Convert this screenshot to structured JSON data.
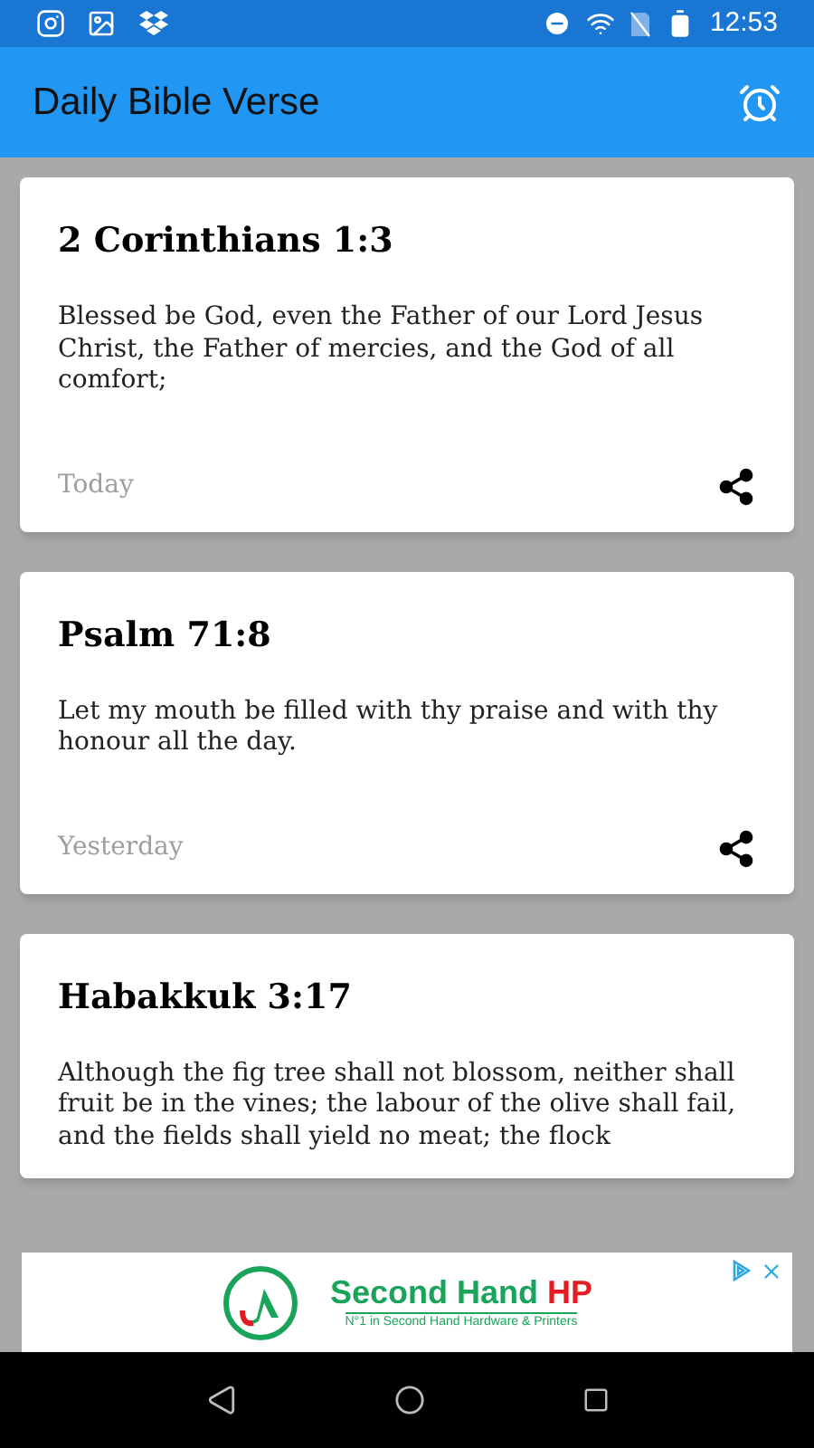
{
  "status_bar": {
    "time": "12:53"
  },
  "app_bar": {
    "title": "Daily Bible Verse"
  },
  "verses": [
    {
      "reference": "2 Corinthians 1:3",
      "text": "Blessed be God, even the Father of our Lord Jesus Christ, the Father of mercies, and the God of all comfort;",
      "date": "Today"
    },
    {
      "reference": "Psalm 71:8",
      "text": "Let my mouth be filled with thy praise and with thy honour all the day.",
      "date": "Yesterday"
    },
    {
      "reference": "Habakkuk 3:17",
      "text": "Although the fig tree shall not blossom, neither shall fruit be in the vines; the labour of the olive shall fail, and the fields shall yield no meat; the flock"
    }
  ],
  "ad": {
    "brand": "Second Hand",
    "brand_accent": "HP",
    "tagline": "N°1 in Second Hand Hardware & Printers"
  }
}
